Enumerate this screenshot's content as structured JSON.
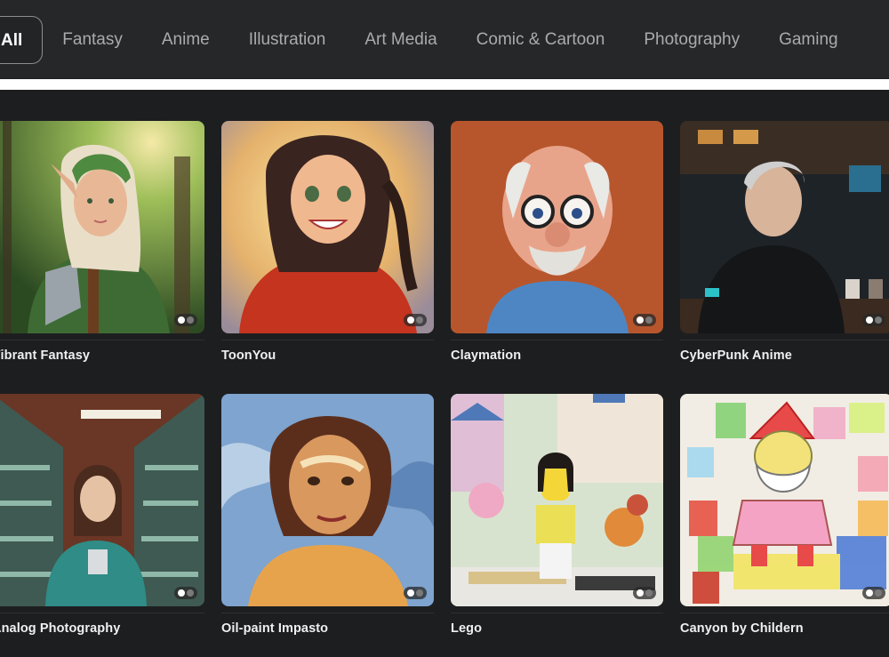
{
  "tabs": [
    {
      "label": "All",
      "active": true
    },
    {
      "label": "Fantasy"
    },
    {
      "label": "Anime"
    },
    {
      "label": "Illustration"
    },
    {
      "label": "Art Media"
    },
    {
      "label": "Comic & Cartoon"
    },
    {
      "label": "Photography"
    },
    {
      "label": "Gaming"
    }
  ],
  "styles": [
    {
      "title": "Vibrant Fantasy",
      "icon": "elf-warrior-image"
    },
    {
      "title": "ToonYou",
      "icon": "cartoon-girl-image"
    },
    {
      "title": "Claymation",
      "icon": "clay-old-man-image"
    },
    {
      "title": "CyberPunk Anime",
      "icon": "cyberpunk-man-image"
    },
    {
      "title": "Analog Photography",
      "icon": "woman-in-store-image"
    },
    {
      "title": "Oil-paint Impasto",
      "icon": "impasto-portrait-image"
    },
    {
      "title": "Lego",
      "icon": "lego-figure-image"
    },
    {
      "title": "Canyon by Childern",
      "icon": "child-drawing-santa-image"
    }
  ],
  "colors": {
    "background": "#1d1e20",
    "topbar": "#262729",
    "tab_text": "#a9abae",
    "active_tab_text": "#ffffff"
  }
}
